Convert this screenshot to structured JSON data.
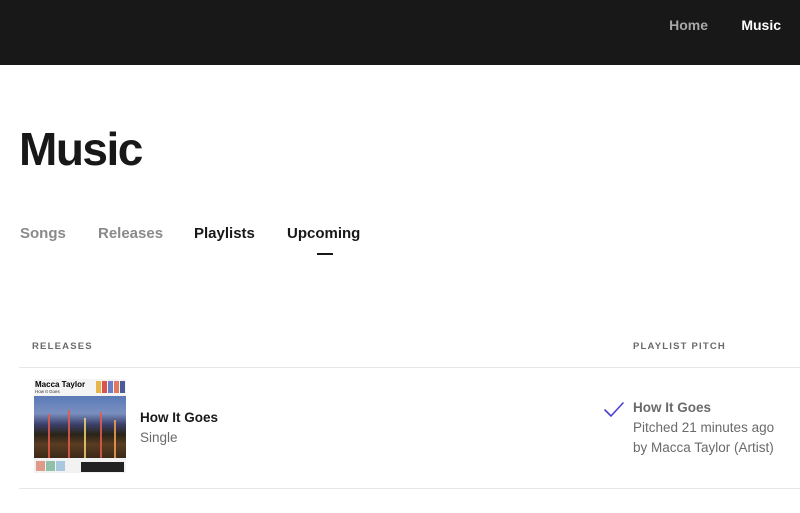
{
  "topbar": {
    "nav": [
      {
        "label": "Home",
        "active": false
      },
      {
        "label": "Music",
        "active": true
      }
    ]
  },
  "page": {
    "title": "Music"
  },
  "tabs": [
    {
      "label": "Songs",
      "active": false
    },
    {
      "label": "Releases",
      "active": false
    },
    {
      "label": "Playlists",
      "active": false
    },
    {
      "label": "Upcoming",
      "active": true
    }
  ],
  "table": {
    "columns": {
      "releases": "RELEASES",
      "pitch": "PLAYLIST PITCH"
    },
    "rows": [
      {
        "artwork": {
          "artist": "Macca Taylor",
          "title": "How It Goes"
        },
        "title": "How It Goes",
        "type": "Single",
        "pitch": {
          "status_icon": "check-icon",
          "title": "How It Goes",
          "time": "Pitched 21 minutes ago",
          "by": "by Macca Taylor (Artist)"
        }
      }
    ]
  },
  "colors": {
    "topbar_bg": "#181818",
    "accent_check": "#4b3fd8",
    "muted_text": "#6a6a6a"
  }
}
